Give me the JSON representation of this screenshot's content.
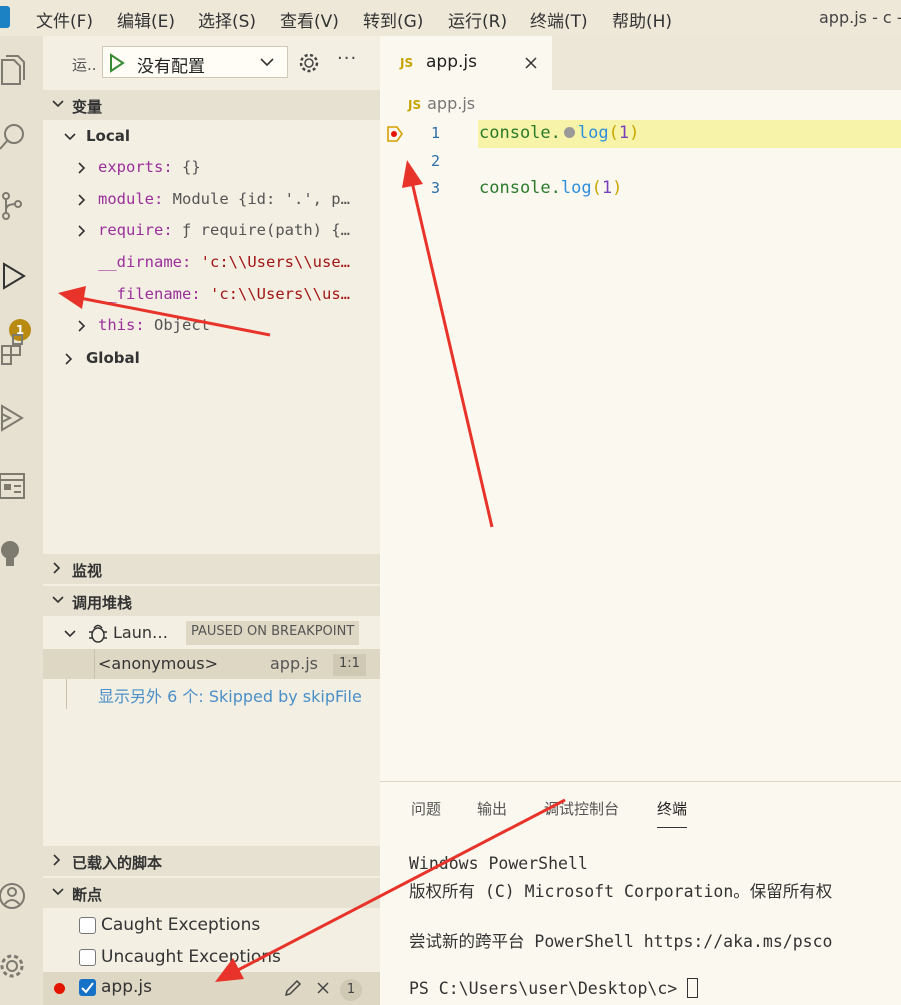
{
  "menubar": {
    "items": [
      "文件(F)",
      "编辑(E)",
      "选择(S)",
      "查看(V)",
      "转到(G)",
      "运行(R)",
      "终端(T)",
      "帮助(H)"
    ],
    "window_title": "app.js - c -"
  },
  "activitybar": {
    "icons": [
      "files-icon",
      "search-icon",
      "source-control-icon",
      "run-debug-icon",
      "extensions-icon",
      "remote-icon",
      "preview-icon",
      "lightbulb-icon",
      "account-icon",
      "settings-gear-icon"
    ],
    "debug_badge": "1"
  },
  "sidebar": {
    "run_label": "运..",
    "config_select": "没有配置",
    "sections": {
      "variables": "变量",
      "watch": "监视",
      "callstack": "调用堆栈",
      "loaded_scripts": "已载入的脚本",
      "breakpoints": "断点"
    },
    "variables": {
      "local_label": "Local",
      "global_label": "Global",
      "items": [
        {
          "name": "exports",
          "value": "{}"
        },
        {
          "name": "module",
          "value": "Module {id: '.', p…"
        },
        {
          "name": "require",
          "value": "ƒ require(path) {…"
        },
        {
          "name": "__dirname",
          "value": "'c:\\\\Users\\\\use…"
        },
        {
          "name": "__filename",
          "value": "'c:\\\\Users\\\\us…"
        },
        {
          "name": "this",
          "value": "Object"
        }
      ]
    },
    "callstack": {
      "session_label": "Laun…",
      "status": "PAUSED ON BREAKPOINT",
      "frame_name": "<anonymous>",
      "frame_file": "app.js",
      "frame_pos": "1:1",
      "skipped": "显示另外 6 个: Skipped by skipFile"
    },
    "breakpoints": {
      "items": [
        {
          "label": "Caught Exceptions",
          "checked": false
        },
        {
          "label": "Uncaught Exceptions",
          "checked": false
        }
      ],
      "file": {
        "label": "app.js",
        "checked": true,
        "count": "1"
      }
    }
  },
  "editor": {
    "tab_badge": "JS",
    "tab_label": "app.js",
    "breadcrumb_badge": "JS",
    "breadcrumb": "app.js",
    "lines": [
      {
        "num": "1",
        "obj": "console",
        "fn": "log",
        "arg": "1",
        "paused": true
      },
      {
        "num": "2"
      },
      {
        "num": "3",
        "obj": "console",
        "fn": "log",
        "arg": "1",
        "paused": false
      }
    ]
  },
  "panel": {
    "tabs": [
      "问题",
      "输出",
      "调试控制台",
      "终端"
    ],
    "active_tab": "终端",
    "terminal": [
      "Windows PowerShell",
      "版权所有 (C) Microsoft Corporation。保留所有权",
      "",
      "尝试新的跨平台 PowerShell https://aka.ms/psco",
      "",
      "PS C:\\Users\\user\\Desktop\\c> "
    ]
  },
  "colors": {
    "accent_debug_line": "#f7f3a8",
    "annotation_arrow": "#e8332a",
    "breakpoint_red": "#e51400",
    "badge": "#b88a12"
  }
}
